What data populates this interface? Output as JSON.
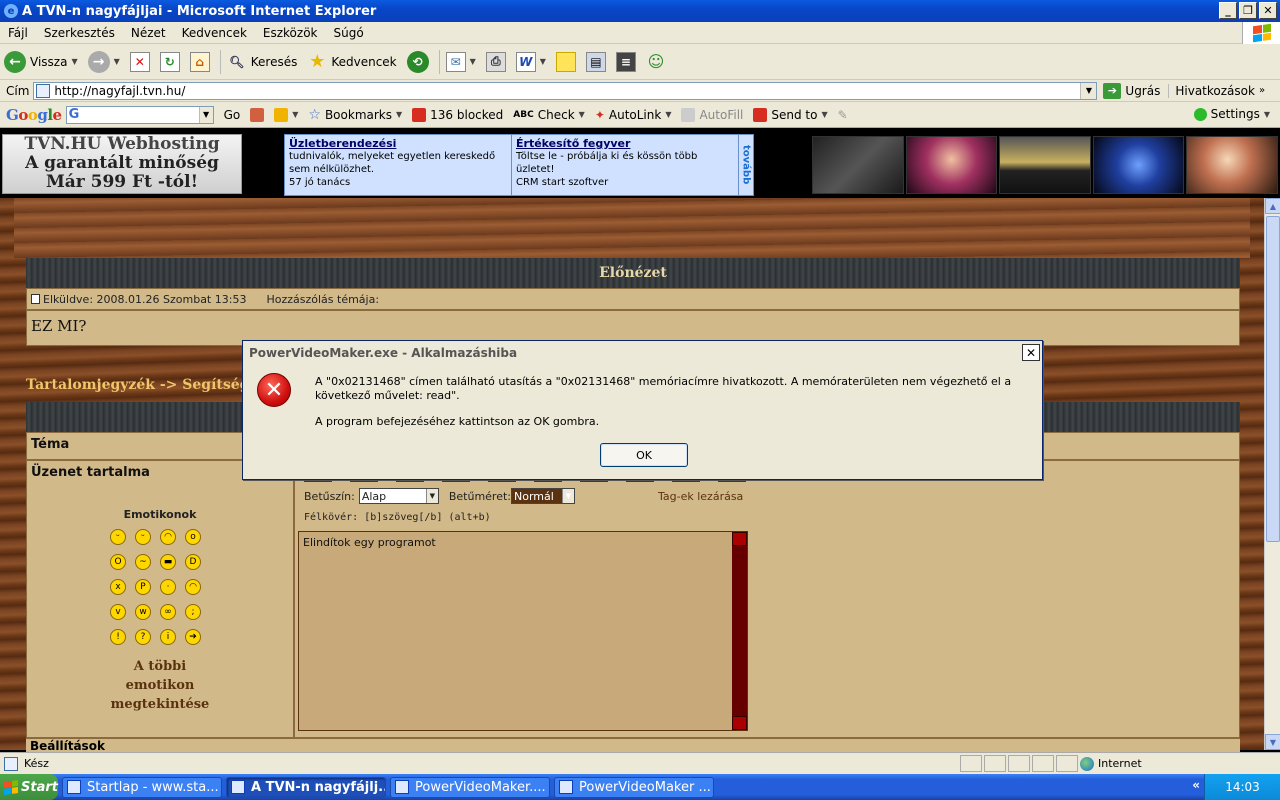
{
  "window": {
    "title": "A TVN-n nagyfájljai - Microsoft Internet Explorer"
  },
  "menu": [
    "Fájl",
    "Szerkesztés",
    "Nézet",
    "Kedvencek",
    "Eszközök",
    "Súgó"
  ],
  "toolbar": {
    "back": "Vissza",
    "search": "Keresés",
    "favorites": "Kedvencek"
  },
  "address": {
    "label": "Cím",
    "url": "http://nagyfajl.tvn.hu/",
    "go": "Ugrás",
    "links": "Hivatkozások"
  },
  "google_bar": {
    "logo": "Google",
    "go": "Go",
    "bookmarks": "Bookmarks",
    "blocked": "136 blocked",
    "check": "Check",
    "autolink": "AutoLink",
    "autofill": "AutoFill",
    "send_to": "Send to",
    "settings": "Settings"
  },
  "banner": {
    "webhost_l1": "TVN.HU Webhosting",
    "webhost_l2": "A garantált minőség",
    "webhost_l3": "Már 599 Ft -tól!",
    "ad1_title": "Üzletberendezési",
    "ad1_text": "tudnivalók, melyeket egyetlen kereskedő sem nélkülözhet.",
    "ad1_sub": "57 jó tanács",
    "ad2_title": "Értékesítő fegyver",
    "ad2_text": "Töltse le - próbálja ki és kössön több üzletet!",
    "ad2_sub": "CRM start szoftver",
    "tovabb": "tovább"
  },
  "preview": {
    "header": "Előnézet",
    "sent": "Elküldve: 2008.01.26 Szombat 13:53",
    "subject_label": "Hozzászólás témája:",
    "body": "EZ MI?"
  },
  "breadcrumb": "Tartalomjegyzék -> Segítség",
  "form": {
    "topic_label": "Téma",
    "message_label": "Üzenet tartalma",
    "emoticons_title": "Emotikonok",
    "more_emoticons_1": "A többi",
    "more_emoticons_2": "emotikon",
    "more_emoticons_3": "megtekintése",
    "font_color_label": "Betűszín:",
    "font_color_value": "Alap",
    "font_size_label": "Betűméret:",
    "font_size_value": "Normál",
    "close_tags": "Tag-ek lezárása",
    "hint": "Félkövér: [b]szöveg[/b]  (alt+b)",
    "message_value": "Elindítok egy programot",
    "settings_label": "Beállítások"
  },
  "dialog": {
    "title": "PowerVideoMaker.exe - Alkalmazáshiba",
    "message": "A \"0x02131468\" címen található utasítás a \"0x02131468\" memóriacímre hivatkozott. A memóraterületen nem végezhető el a következő művelet: read\".",
    "message2": "A program befejezéséhez kattintson az OK gombra.",
    "ok": "OK"
  },
  "status": {
    "text": "Kész",
    "zone": "Internet"
  },
  "taskbar": {
    "start": "Start",
    "tasks": [
      "Startlap - www.sta...",
      "A TVN-n nagyfájlj...",
      "PowerVideoMaker....",
      "PowerVideoMaker ..."
    ],
    "tray_arrow": "«",
    "clock": "14:03"
  }
}
